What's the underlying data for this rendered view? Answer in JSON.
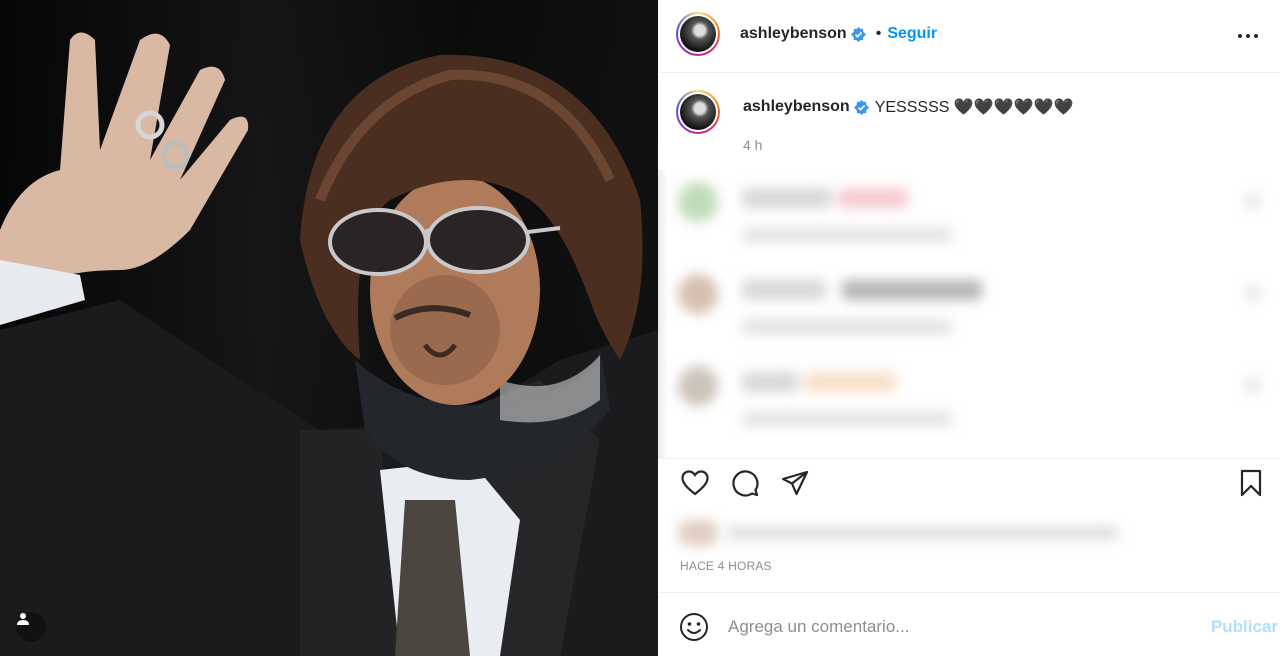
{
  "post": {
    "username": "ashleybenson",
    "separator": "•",
    "follow_label": "Seguir",
    "more_icon": "more-options-icon",
    "caption_user": "ashleybenson",
    "caption_text": "YESSSSS 🖤🖤🖤🖤🖤🖤",
    "caption_age": "4 h",
    "posted_time": "HACE 4 HORAS"
  },
  "actions": {
    "like_icon": "heart-icon",
    "comment_icon": "comment-icon",
    "share_icon": "share-icon",
    "save_icon": "bookmark-icon"
  },
  "composer": {
    "placeholder": "Agrega un comentario...",
    "publish_label": "Publicar"
  },
  "colors": {
    "accent": "#0095f6",
    "publish_disabled": "#b2dffc",
    "muted": "#8e8e8e",
    "verified": "#3897f0"
  }
}
